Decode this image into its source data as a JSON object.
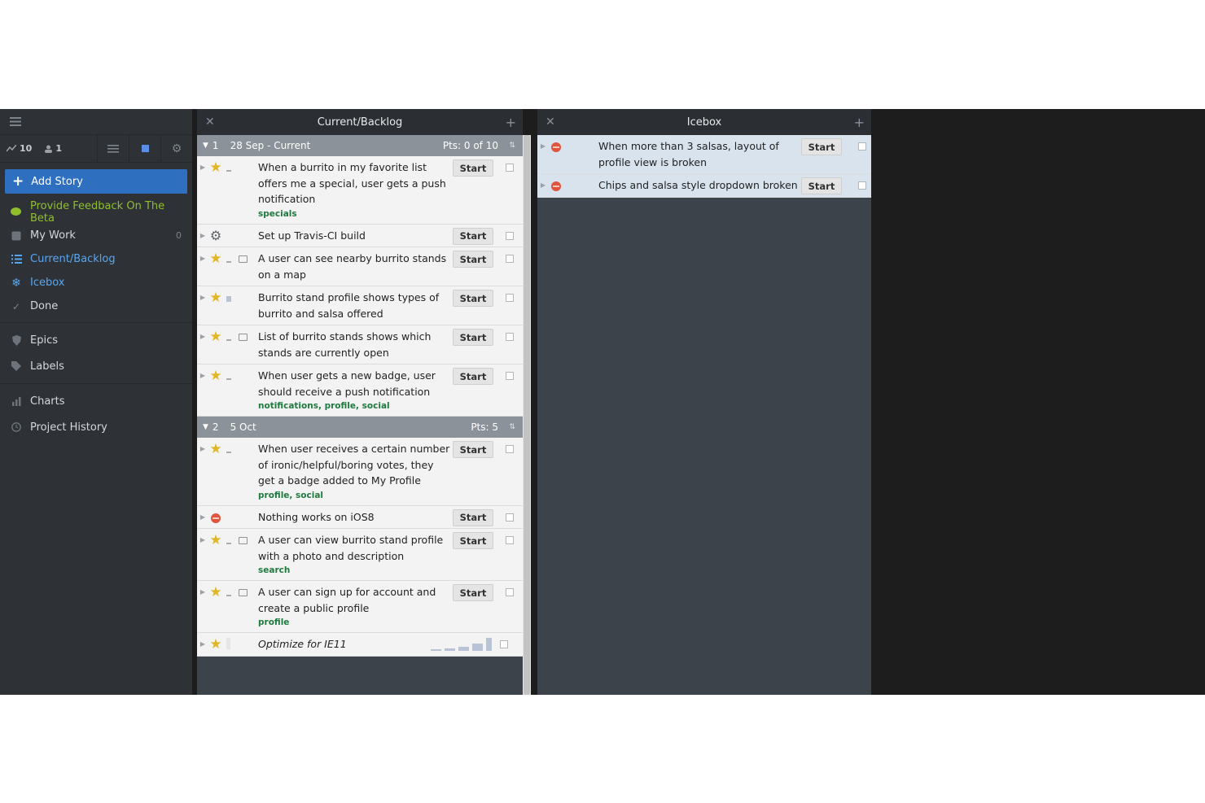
{
  "sidebar": {
    "stats": {
      "velocity": "10",
      "members": "1"
    },
    "add_story": "Add Story",
    "nav": [
      {
        "label": "Provide Feedback On The Beta",
        "icon": "chat-bubble-icon"
      },
      {
        "label": "My Work",
        "icon": "inbox-icon",
        "count": "0"
      },
      {
        "label": "Current/Backlog",
        "icon": "list-icon"
      },
      {
        "label": "Icebox",
        "icon": "snowflake-icon"
      },
      {
        "label": "Done",
        "icon": "check-icon"
      },
      {
        "label": "Epics",
        "icon": "shield-icon"
      },
      {
        "label": "Labels",
        "icon": "tag-icon"
      },
      {
        "label": "Charts",
        "icon": "bar-chart-icon"
      },
      {
        "label": "Project History",
        "icon": "clock-icon"
      }
    ]
  },
  "backlog": {
    "title": "Current/Backlog",
    "iterations": [
      {
        "num": "1",
        "date": "28 Sep - Current",
        "pts": "Pts: 0 of 10",
        "stories": [
          {
            "text": "When a burrito in my favorite list offers me a special, user gets a push notification",
            "labels": "specials",
            "button": "Start"
          },
          {
            "text": "Set up Travis-CI build",
            "labels": "",
            "button": "Start"
          },
          {
            "text": "A user can see nearby burrito stands on a map",
            "labels": "",
            "button": "Start"
          },
          {
            "text": "Burrito stand profile shows types of burrito and salsa offered",
            "labels": "",
            "button": "Start"
          },
          {
            "text": "List of burrito stands shows which stands are currently open",
            "labels": "",
            "button": "Start"
          },
          {
            "text": "When user gets a new badge, user should receive a push notification",
            "labels": "notifications, profile, social",
            "button": "Start"
          }
        ]
      },
      {
        "num": "2",
        "date": "5 Oct",
        "pts": "Pts: 5",
        "stories": [
          {
            "text": "When user receives a certain number of ironic/helpful/boring votes, they get a badge added to My Profile",
            "labels": "profile, social",
            "button": "Start"
          },
          {
            "text": "Nothing works on iOS8",
            "labels": "",
            "button": "Start"
          },
          {
            "text": "A user can view burrito stand profile with a photo and description",
            "labels": "search",
            "button": "Start"
          },
          {
            "text": "A user can sign up for account and create a public profile",
            "labels": "profile",
            "button": "Start"
          },
          {
            "text": "Optimize for IE11",
            "labels": ""
          }
        ]
      }
    ]
  },
  "icebox": {
    "title": "Icebox",
    "stories": [
      {
        "text": "When more than 3 salsas, layout of profile view is broken",
        "button": "Start"
      },
      {
        "text": "Chips and salsa style dropdown broken",
        "button": "Start"
      }
    ]
  }
}
